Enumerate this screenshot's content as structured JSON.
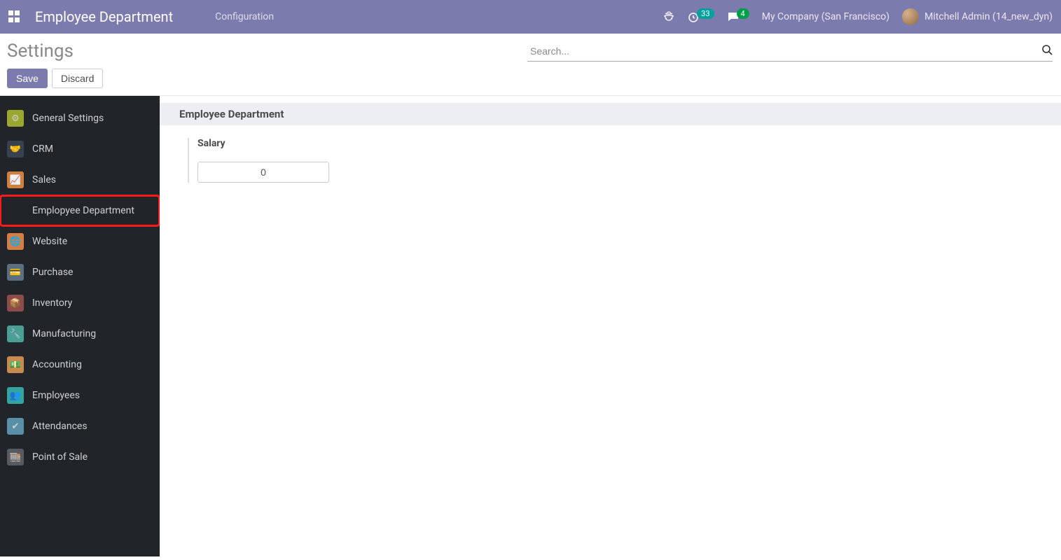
{
  "navbar": {
    "app_title": "Employee Department",
    "menu_config": "Configuration",
    "timer_badge": "33",
    "chat_badge": "4",
    "company": "My Company (San Francisco)",
    "user": "Mitchell Admin (14_new_dyn)"
  },
  "control_panel": {
    "breadcrumb": "Settings",
    "search_placeholder": "Search...",
    "save_label": "Save",
    "discard_label": "Discard"
  },
  "sidebar": {
    "items": [
      {
        "label": "General Settings",
        "icon": "gear-icon",
        "cls": "ic-gear"
      },
      {
        "label": "CRM",
        "icon": "handshake-icon",
        "cls": "ic-crm"
      },
      {
        "label": "Sales",
        "icon": "chart-icon",
        "cls": "ic-sales"
      },
      {
        "label": "Emplopyee Department",
        "icon": "",
        "cls": "ic-none"
      },
      {
        "label": "Website",
        "icon": "globe-icon",
        "cls": "ic-web"
      },
      {
        "label": "Purchase",
        "icon": "card-icon",
        "cls": "ic-cart"
      },
      {
        "label": "Inventory",
        "icon": "box-icon",
        "cls": "ic-inv"
      },
      {
        "label": "Manufacturing",
        "icon": "wrench-icon",
        "cls": "ic-mfg"
      },
      {
        "label": "Accounting",
        "icon": "money-icon",
        "cls": "ic-acct"
      },
      {
        "label": "Employees",
        "icon": "people-icon",
        "cls": "ic-emp"
      },
      {
        "label": "Attendances",
        "icon": "user-check-icon",
        "cls": "ic-att"
      },
      {
        "label": "Point of Sale",
        "icon": "shop-icon",
        "cls": "ic-pos"
      }
    ],
    "active_index": 3
  },
  "content": {
    "section_title": "Employee Department",
    "field_label": "Salary",
    "field_value": "0"
  },
  "icons": {
    "gear-icon": "⚙",
    "handshake-icon": "🤝",
    "chart-icon": "📈",
    "globe-icon": "🌐",
    "card-icon": "💳",
    "box-icon": "📦",
    "wrench-icon": "🔧",
    "money-icon": "💵",
    "people-icon": "👥",
    "user-check-icon": "✔",
    "shop-icon": "🏬"
  }
}
